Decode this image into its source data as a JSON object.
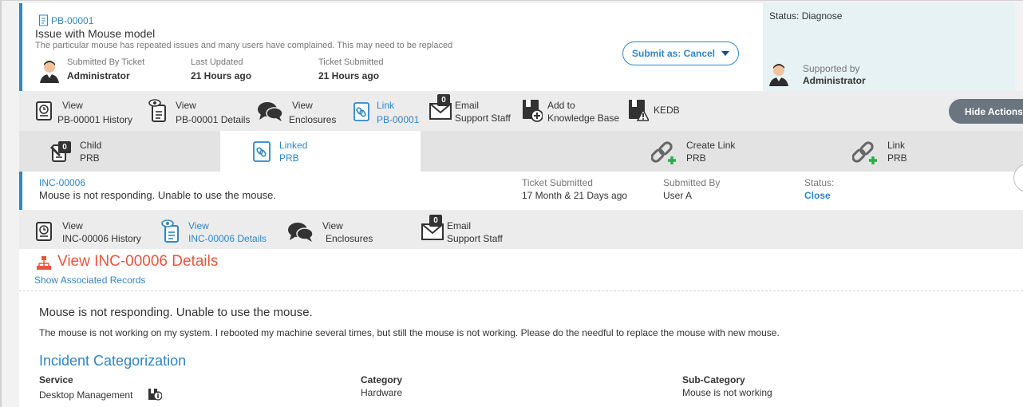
{
  "ticket": {
    "id": "PB-00001",
    "title": "Issue with Mouse model",
    "description": "The particular mouse has repeated issues and many users have complained. This may need to be replaced",
    "submitted_by_label": "Submitted By Ticket",
    "submitted_by": "Administrator",
    "last_updated_label": "Last Updated",
    "last_updated": "21 Hours ago",
    "ticket_submitted_label": "Ticket Submitted",
    "ticket_submitted": "21 Hours ago",
    "submit_button": "Submit as: Cancel"
  },
  "status_panel": {
    "status": "Status: Diagnose",
    "supported_by_label": "Supported by",
    "supported_by": "Administrator"
  },
  "actions": [
    {
      "l1": "View",
      "l2": "PB-00001 History",
      "icon": "history-icon"
    },
    {
      "l1": "View",
      "l2": "PB-00001 Details",
      "icon": "details-eye-icon"
    },
    {
      "l1": "View",
      "l2": "Enclosures",
      "icon": "chat-bubbles-icon"
    },
    {
      "l1": "Link",
      "l2": "PB-00001",
      "icon": "link-icon"
    },
    {
      "l1": "Email",
      "l2": "Support Staff",
      "icon": "email-icon",
      "badge": "0"
    },
    {
      "l1": "Add to",
      "l2": "Knowledge Base",
      "icon": "knowledge-base-icon"
    },
    {
      "l1": "KEDB",
      "l2": "",
      "icon": "kedb-icon"
    }
  ],
  "hide_actions": "Hide Actions",
  "tabs": [
    {
      "l1": "Child",
      "l2": "PRB",
      "badge": "0",
      "icon": "child-edit-icon"
    },
    {
      "l1": "Linked",
      "l2": "PRB",
      "icon": "linked-doc-icon"
    },
    {
      "l1": "Create Link",
      "l2": "PRB",
      "icon": "create-link-icon"
    },
    {
      "l1": "Link",
      "l2": "PRB",
      "icon": "link-add-icon"
    }
  ],
  "linked_record": {
    "id": "INC-00006",
    "title": "Mouse is not responding. Unable to use the mouse.",
    "ticket_submitted_label": "Ticket Submitted",
    "ticket_submitted": "17 Month & 21 Days ago",
    "submitted_by_label": "Submitted By",
    "submitted_by": "User A",
    "status_label": "Status:",
    "status": "Close"
  },
  "record_actions": [
    {
      "l1": "View",
      "l2": "INC-00006 History",
      "icon": "history-icon"
    },
    {
      "l1": "View",
      "l2": "INC-00006 Details",
      "icon": "details-eye-icon"
    },
    {
      "l1": "View",
      "l2": "Enclosures",
      "icon": "chat-bubbles-icon"
    },
    {
      "l1": "Email",
      "l2": "Support Staff",
      "icon": "email-icon",
      "badge": "0"
    }
  ],
  "details": {
    "heading": "View INC-00006 Details",
    "show_associated": "Show Associated Records",
    "subject": "Mouse is not responding. Unable to use the mouse.",
    "body": "The mouse is not working on my system. I rebooted my machine several times, but still the mouse is not working. Please do the needful to replace the mouse with new mouse.",
    "categorization_title": "Incident Categorization",
    "service_label": "Service",
    "service": "Desktop Management",
    "category_label": "Category",
    "category": "Hardware",
    "subcategory_label": "Sub-Category",
    "subcategory": "Mouse is not working"
  },
  "colors": {
    "accent": "#2e86c9",
    "heading_red": "#e8553f",
    "status_panel_bg": "#e6f2f4",
    "plus_green": "#2eaa4a"
  }
}
